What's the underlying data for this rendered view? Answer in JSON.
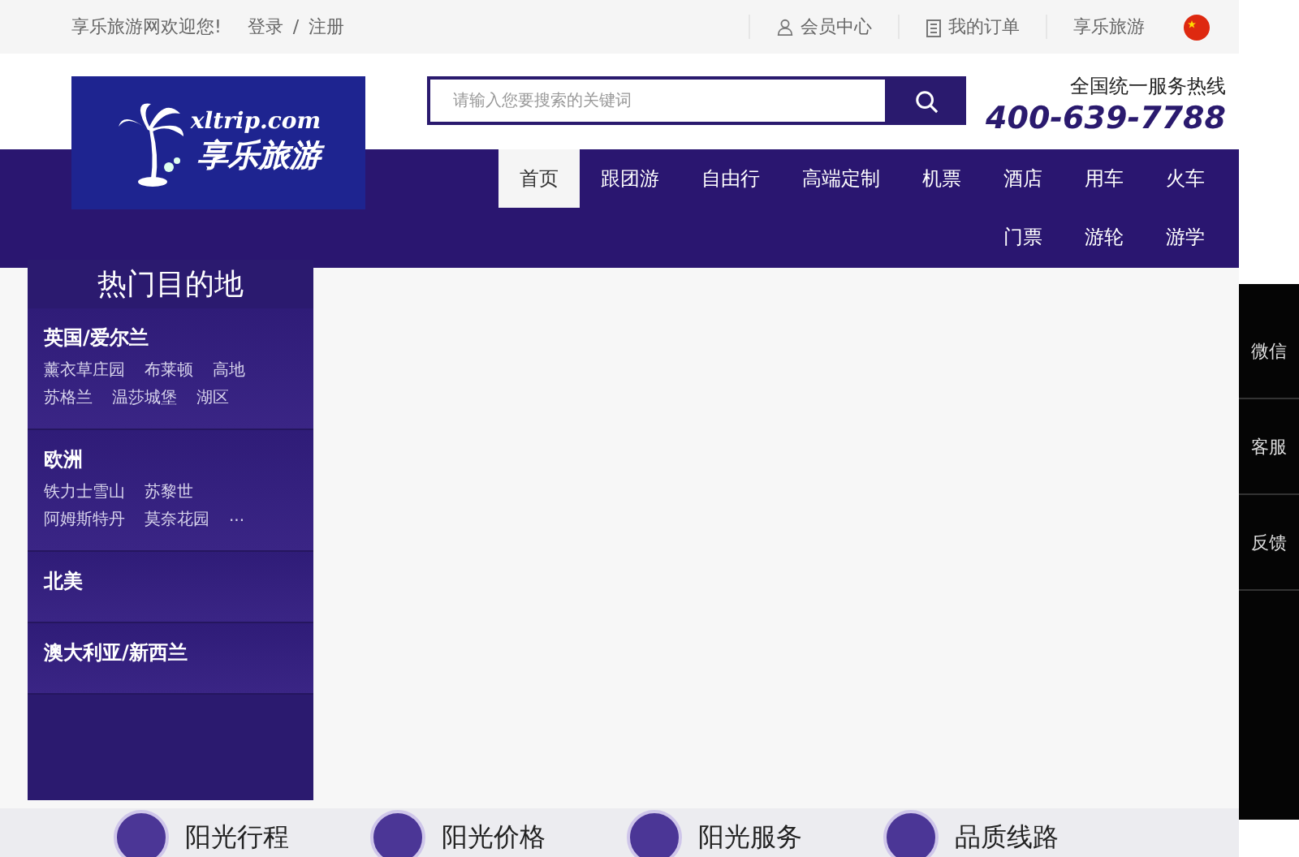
{
  "top_bar": {
    "welcome": "享乐旅游网欢迎您!",
    "login": "登录",
    "separator": "/",
    "register": "注册",
    "links": [
      {
        "kind": "user",
        "label": "会员中心"
      },
      {
        "kind": "order",
        "label": "我的订单"
      },
      {
        "kind": "plain",
        "label": "享乐旅游"
      }
    ]
  },
  "logo": {
    "domain": "xltrip.com",
    "name": "享乐旅游"
  },
  "search": {
    "placeholder": "请输入您要搜索的关键词"
  },
  "hotline": {
    "label": "全国统一服务热线",
    "number": "400-639-7788"
  },
  "nav": [
    {
      "label": "首页",
      "selected": true
    },
    {
      "label": "跟团游",
      "selected": false
    },
    {
      "label": "自由行",
      "selected": false
    },
    {
      "label": "高端定制",
      "selected": false
    },
    {
      "label": "机票",
      "selected": false
    },
    {
      "label": "酒店",
      "selected": false
    },
    {
      "label": "用车",
      "selected": false
    },
    {
      "label": "火车",
      "selected": false
    },
    {
      "label": "门票",
      "selected": false
    },
    {
      "label": "游轮",
      "selected": false
    },
    {
      "label": "游学",
      "selected": false
    }
  ],
  "destinations": {
    "title": "热门目的地",
    "groups": [
      {
        "name": "英国/爱尔兰",
        "places": [
          "薰衣草庄园",
          "布莱顿",
          "高地",
          "苏格兰",
          "温莎城堡",
          "湖区"
        ]
      },
      {
        "name": "欧洲",
        "places": [
          "铁力士雪山",
          "苏黎世",
          "阿姆斯特丹",
          "莫奈花园",
          "..."
        ]
      },
      {
        "name": "北美"
      },
      {
        "name": "澳大利亚/新西兰"
      }
    ]
  },
  "side_tools": [
    "微信",
    "客服",
    "反馈"
  ],
  "features": [
    "阳光行程",
    "阳光价格",
    "阳光服务",
    "品质线路"
  ]
}
